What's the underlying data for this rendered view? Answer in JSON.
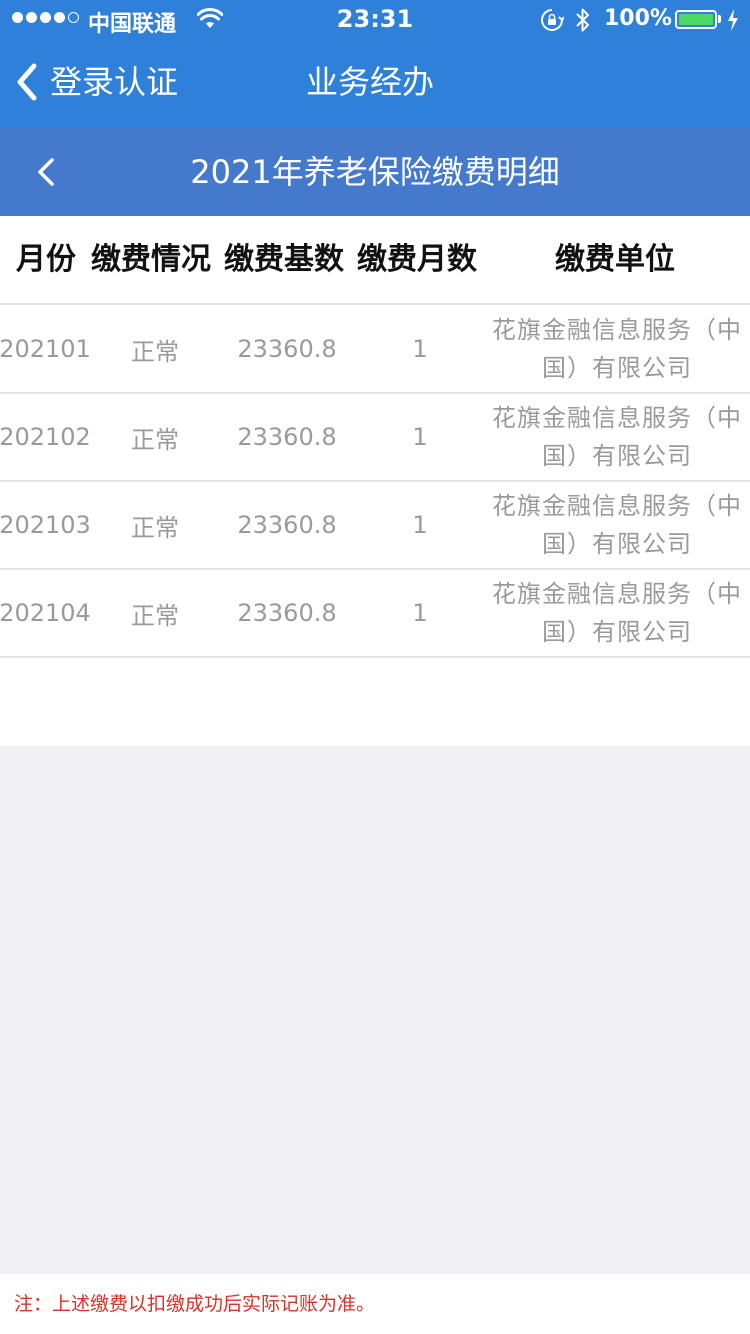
{
  "status_bar": {
    "carrier": "中国联通",
    "time": "23:31",
    "battery": "100%"
  },
  "nav": {
    "back_label": "登录认证",
    "title": "业务经办"
  },
  "subheader": {
    "title": "2021年养老保险缴费明细"
  },
  "table": {
    "headers": [
      "月份",
      "缴费情况",
      "缴费基数",
      "缴费月数",
      "缴费单位"
    ],
    "rows": [
      [
        "202101",
        "正常",
        "23360.8",
        "1",
        "花旗金融信息服务（中国）有限公司"
      ],
      [
        "202102",
        "正常",
        "23360.8",
        "1",
        "花旗金融信息服务（中国）有限公司"
      ],
      [
        "202103",
        "正常",
        "23360.8",
        "1",
        "花旗金融信息服务（中国）有限公司"
      ],
      [
        "202104",
        "正常",
        "23360.8",
        "1",
        "花旗金融信息服务（中国）有限公司"
      ]
    ]
  },
  "footer": {
    "note": "注：上述缴费以扣缴成功后实际记账为准。"
  },
  "colors": {
    "nav_blue": "#2f80d8",
    "subheader_blue": "#4479cc",
    "note_red": "#d8332a",
    "battery_green": "#4cd964"
  }
}
